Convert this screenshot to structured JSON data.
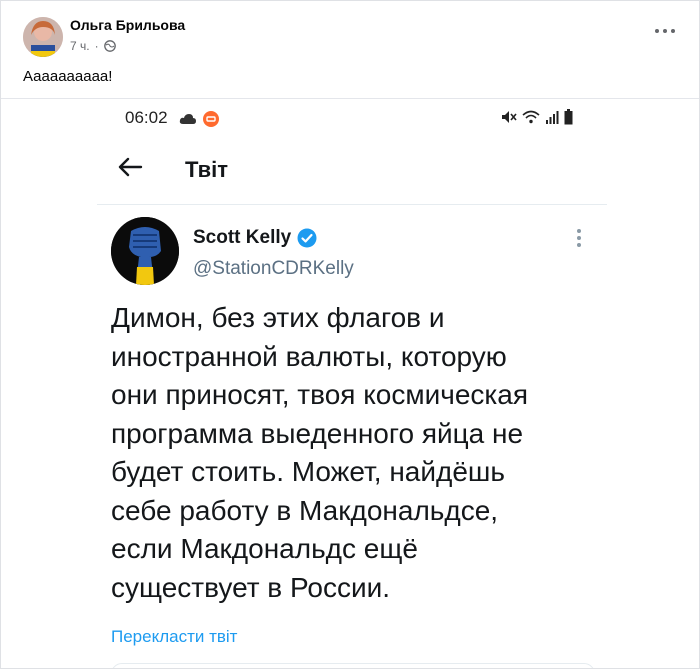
{
  "facebook": {
    "author_name": "Ольга Брильова",
    "time_ago": "7 ч.",
    "post_text": "Аааааааааа!"
  },
  "screenshot": {
    "status_time": "06:02",
    "header_title": "Твіт",
    "tweet": {
      "display_name": "Scott Kelly",
      "handle": "@StationCDRKelly",
      "text_lines": [
        "Димон, без этих флагов и",
        "иностранной валюты, которую",
        "они приносят, твоя космическая",
        "программа выеденного яйца не",
        "будет стоить. Может, найдёшь",
        "себе работу в Макдональдсе,",
        "если Макдональдс ещё",
        "существует в России."
      ],
      "translate_label": "Перекласти твіт"
    }
  },
  "colors": {
    "twitter_blue": "#1d9bf0",
    "handle_gray": "#5b7083",
    "fb_meta_gray": "#65676b"
  }
}
